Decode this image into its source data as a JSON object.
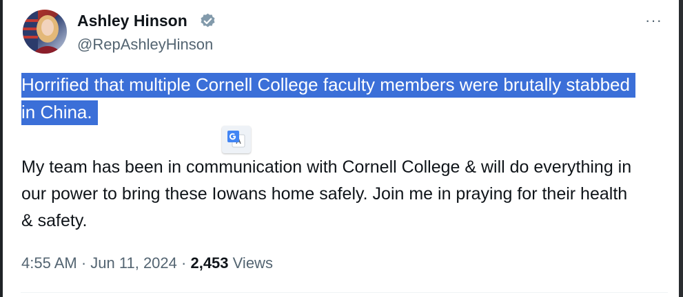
{
  "author": {
    "name": "Ashley Hinson",
    "handle": "@RepAshleyHinson",
    "verified_icon": "verified-badge-icon"
  },
  "tweet": {
    "highlighted_text": "Horrified that multiple Cornell College faculty members were brutally stabbed in China.",
    "body_text": "My team has been in communication with Cornell College & will do everything in our power to bring these Iowans home safely. Join me in praying for their health & safety.",
    "time": "4:55 AM",
    "separator": "·",
    "date": "Jun 11, 2024",
    "views_count": "2,453",
    "views_label": "Views"
  },
  "menu": {
    "more_label": "···"
  },
  "colors": {
    "highlight": "#3b6fd8",
    "secondary_text": "#536471",
    "primary_text": "#0f1419"
  }
}
